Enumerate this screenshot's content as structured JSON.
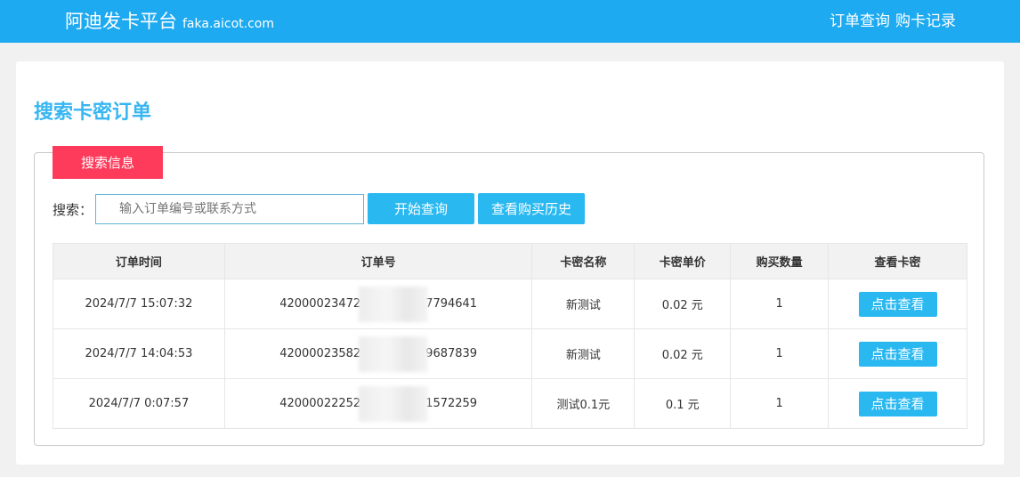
{
  "header": {
    "brand_name": "阿迪发卡平台",
    "brand_domain": "faka.aicot.com",
    "nav": [
      "订单查询",
      "购卡记录"
    ]
  },
  "page": {
    "title": "搜索卡密订单"
  },
  "search": {
    "legend": "搜索信息",
    "label": "搜索：",
    "placeholder": "输入订单编号或联系方式",
    "value": "",
    "search_button": "开始查询",
    "history_button": "查看购买历史"
  },
  "table": {
    "headers": [
      "订单时间",
      "订单号",
      "卡密名称",
      "卡密单价",
      "购买数量",
      "查看卡密"
    ],
    "rows": [
      {
        "time": "2024/7/7 15:07:32",
        "order_no": "42000023472████7794641",
        "order_no_prefix": "42000023472",
        "order_no_suffix": "7794641",
        "name": "新测试",
        "price": "0.02 元",
        "qty": "1",
        "action": "点击查看"
      },
      {
        "time": "2024/7/7 14:04:53",
        "order_no": "42000023582████9687839",
        "order_no_prefix": "42000023582",
        "order_no_suffix": "9687839",
        "name": "新测试",
        "price": "0.02 元",
        "qty": "1",
        "action": "点击查看"
      },
      {
        "time": "2024/7/7 0:07:57",
        "order_no": "42000022252████1572259",
        "order_no_prefix": "42000022252",
        "order_no_suffix": "1572259",
        "name": "测试0.1元",
        "price": "0.1 元",
        "qty": "1",
        "action": "点击查看"
      }
    ]
  },
  "colors": {
    "header_bg": "#1eaaf1",
    "title": "#38b6f1",
    "legend_bg": "#ff3b5b",
    "button_bg": "#2ab8f0"
  }
}
